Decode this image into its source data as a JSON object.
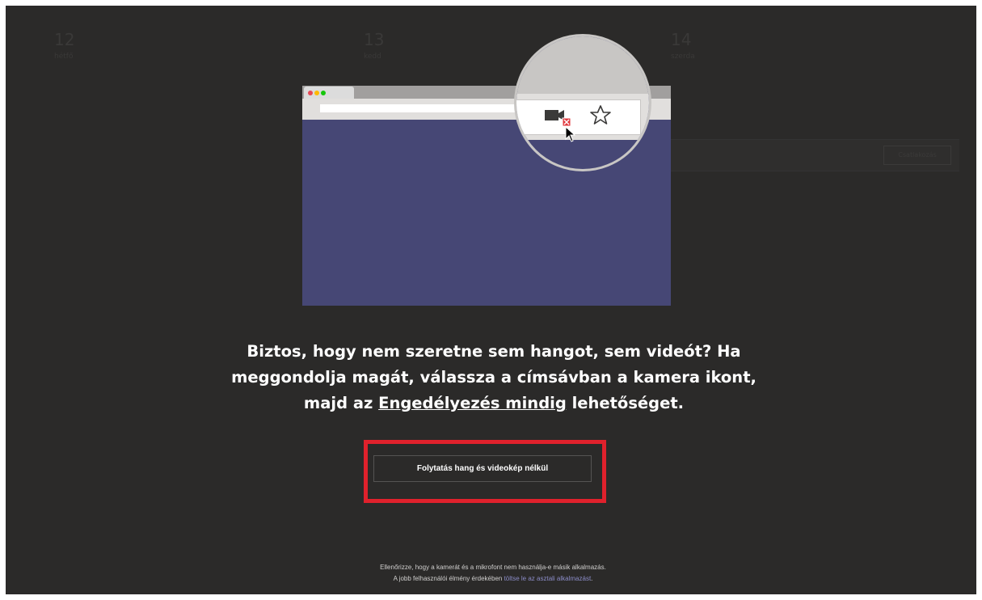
{
  "background_calendar": {
    "days": [
      {
        "number": "12",
        "label": "hétfő"
      },
      {
        "number": "13",
        "label": "kedd"
      },
      {
        "number": "14",
        "label": "szerda"
      }
    ],
    "join_label": "Csatlakozás"
  },
  "dialog": {
    "message_part1": "Biztos, hogy nem szeretne sem hangot, sem videót? Ha meggondolja magát, válassza a címsávban a kamera ikont, majd az ",
    "message_link": "Engedélyezés mindig",
    "message_part2": " lehetőséget.",
    "continue_button": "Folytatás hang és videokép nélkül",
    "footer_line1": "Ellenőrizze, hogy a kamerát és a mikrofont nem használja-e másik alkalmazás.",
    "footer_line2_prefix": "A jobb felhasználói élmény érdekében ",
    "footer_link": "töltse le az asztali alkalmazást",
    "footer_line2_suffix": "."
  },
  "colors": {
    "background": "#2b2a29",
    "browser_body": "#464775",
    "highlight": "#e0212c",
    "link": "#8b8cc7"
  },
  "icons": [
    "camera-blocked-icon",
    "star-icon",
    "cursor-icon"
  ]
}
